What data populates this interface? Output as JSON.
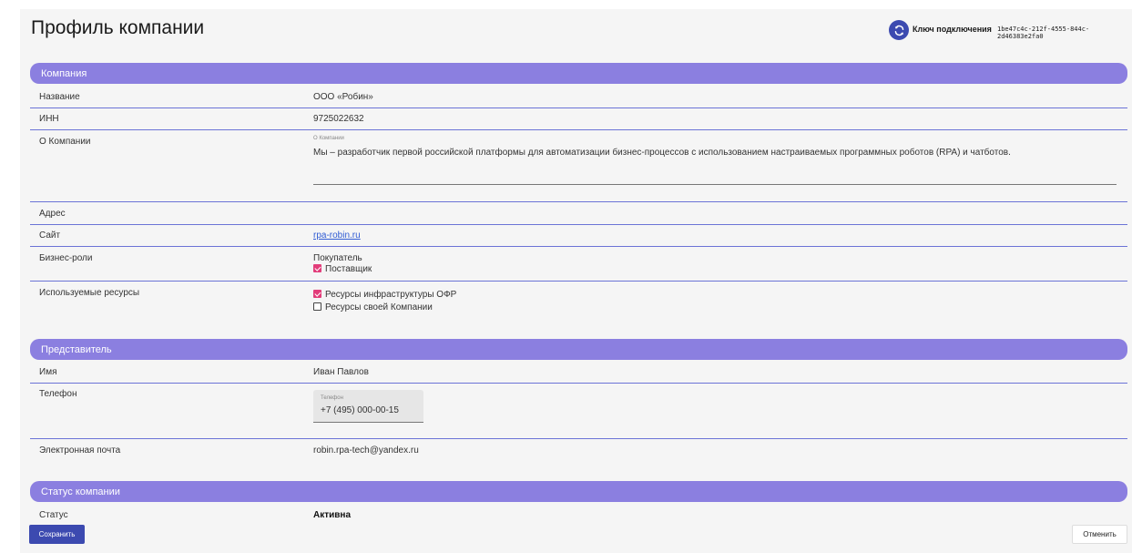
{
  "page": {
    "title": "Профиль компании",
    "connection_key_label": "Ключ подключения",
    "connection_key_value": "1be47c4c-212f-4555-844c-2d46383e2fa0"
  },
  "company": {
    "header": "Компания",
    "name_label": "Название",
    "name_value": "ООО «Робин»",
    "inn_label": "ИНН",
    "inn_value": "9725022632",
    "about_label": "О Компании",
    "about_placeholder": "О Компании",
    "about_value": "Мы – разработчик первой российской платформы для автоматизации бизнес-процессов с использованием настраиваемых программных роботов (RPA) и чатботов.",
    "address_label": "Адрес",
    "site_label": "Сайт",
    "site_value": "rpa-robin.ru",
    "roles_label": "Бизнес-роли",
    "roles": [
      {
        "label": "Покупатель",
        "checkbox": false
      },
      {
        "label": "Поставщик",
        "checkbox": true,
        "checked": true
      }
    ],
    "resources_label": "Используемые ресурсы",
    "resources": [
      {
        "label": "Ресурсы инфраструктуры ОФР",
        "checked": true
      },
      {
        "label": "Ресурсы своей Компании",
        "checked": false
      }
    ]
  },
  "representative": {
    "header": "Представитель",
    "name_label": "Имя",
    "name_value": "Иван Павлов",
    "phone_label": "Телефон",
    "phone_placeholder": "Телефон",
    "phone_value": "+7 (495) 000-00-15",
    "email_label": "Электронная почта",
    "email_value": "robin.rpa-tech@yandex.ru"
  },
  "status": {
    "header": "Статус компании",
    "status_label": "Статус",
    "status_value": "Активна"
  },
  "actions": {
    "save_label": "Сохранить",
    "cancel_label": "Отменить"
  },
  "colors": {
    "section_header": "#8b7fe0",
    "primary_button": "#3c4ab0",
    "checkbox_checked": "#e23d7a",
    "divider": "#6b73d6"
  },
  "icons": {
    "connection_key": "refresh-icon"
  }
}
